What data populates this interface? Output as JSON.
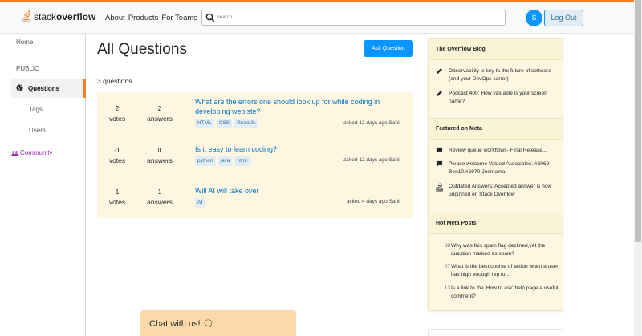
{
  "header": {
    "logo_light": "stack",
    "logo_bold": "overflow",
    "nav": [
      "About",
      "Products",
      "For Teams"
    ],
    "search_placeholder": "Search...",
    "avatar_letter": "S",
    "logout_label": "Log Out"
  },
  "sidebar": {
    "home": "Home",
    "section": "PUBLIC",
    "questions": "Questions",
    "tags": "Tags",
    "users": "Users",
    "community": "Community"
  },
  "main": {
    "title": "All Questions",
    "ask_button": "Ask Question",
    "count": "3 questions",
    "questions": [
      {
        "votes_num": "2",
        "votes_label": "votes",
        "answers_num": "2",
        "answers_label": "answers",
        "title": "What are the errors one should look up for while coding in developing webiste?",
        "tags": [
          "HTML",
          "CSS",
          "ReactJs"
        ],
        "asked": "asked 12 days ago Sahil"
      },
      {
        "votes_num": "-1",
        "votes_label": "votes",
        "answers_num": "0",
        "answers_label": "answers",
        "title": "Is it easy to learn coding?",
        "tags": [
          "python",
          "java",
          "html"
        ],
        "asked": "asked 12 days ago Sahil"
      },
      {
        "votes_num": "1",
        "votes_label": "votes",
        "answers_num": "1",
        "answers_label": "answers",
        "title": "Will AI will take over",
        "tags": [
          "AI"
        ],
        "asked": "asked 4 days ago Sahil"
      }
    ]
  },
  "chat": {
    "label": "Chat with us! 🗨"
  },
  "right": {
    "blog_title": "The Overflow Blog",
    "blog_items": [
      "Observability is key to the future of software (and your DevOps carrer)",
      "Podcast 400: How valuable is your screen name?"
    ],
    "meta_title": "Featured on Meta",
    "meta_items": [
      "Review queue workflows- Final Release...",
      "Please welcome Valued Associates: #6969-Ben10,#6970-Joemama",
      "Outdated Answers: Accepted answer is now unpinned on Stack Overflow"
    ],
    "hot_title": "Hot Meta Posts",
    "hot_items": [
      {
        "num": "38",
        "text": "Why was this spam flag declined,yet the question marked as spam?"
      },
      {
        "num": "07",
        "text": "What is the best course of action when a user has high enough rep to..."
      },
      {
        "num": "13",
        "text": "Is a link to the 'How to ask' help page a useful comment?"
      }
    ]
  },
  "colors": {
    "accent": "#f48024",
    "link": "#0074cc",
    "button": "#0a95ff",
    "panel": "#fdf7e2",
    "tag_bg": "#e1ecf4",
    "community": "#9c27b0"
  }
}
